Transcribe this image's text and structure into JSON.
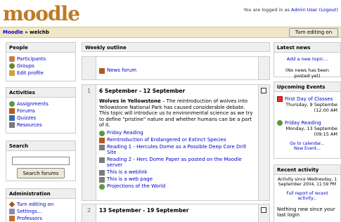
{
  "header": {
    "logo_text": "moodle",
    "login_prefix": "You are logged in as",
    "login_user": "Admin User",
    "logout_label": "(Logout)"
  },
  "navbar": {
    "breadcrumb_home": "Moodle",
    "breadcrumb_sep": "»",
    "breadcrumb_course": "welchb",
    "editing_button": "Turn editing on"
  },
  "people": {
    "title": "People",
    "items": [
      "Participants",
      "Groups",
      "Edit profile"
    ]
  },
  "activities": {
    "title": "Activities",
    "items": [
      "Assignments",
      "Forums",
      "Quizzes",
      "Resources"
    ]
  },
  "search": {
    "title": "Search",
    "button": "Search forums"
  },
  "administration": {
    "title": "Administration",
    "items": [
      "Turn editing on",
      "Settings...",
      "Professors"
    ]
  },
  "outline": {
    "title": "Weekly outline",
    "news_forum": "News forum",
    "week1": {
      "number": "1",
      "title": "6 September - 12 September",
      "summary_bold": "Wolves in Yellowstone",
      "summary_rest": " – The reintroduction of wolves into Yellowstone National Park has caused considerable debate. This topic will introduce us to environmental science as we try to define \"pristine\" nature and whether humans can be a part of it.",
      "activities": [
        "Friday Reading",
        "Reintroduction of Endangered or Extinct Species",
        "Reading 1 - Hercules Dome as a Possible Deep Core Drill Site",
        "Reading 2 - Herc Dome Paper as posted on the Moodle server",
        "This is a weblink",
        "This is a web page",
        "Projections of the World"
      ]
    },
    "week2": {
      "number": "2",
      "title": "13 September - 19 September"
    }
  },
  "latest_news": {
    "title": "Latest news",
    "add_link": "Add a new topic...",
    "empty": "(No news has been posted yet)"
  },
  "upcoming": {
    "title": "Upcoming Events",
    "event1_title": "First Day of Classes",
    "event1_date": "Thursday, 9 Septembe",
    "event1_time": "(12:00 AM",
    "event2_title": "Friday Reading",
    "event2_date": "Monday, 13 Septembe",
    "event2_time": "(09:15 AM",
    "go_calendar": "Go to calendar...",
    "new_event": "New Event..."
  },
  "recent": {
    "title": "Recent activity",
    "since": "Activity since Wednesday, 1 September 2004, 11:59 PM",
    "full_report": "Full report of recent activity...",
    "nothing": "Nothing new since your last login"
  }
}
